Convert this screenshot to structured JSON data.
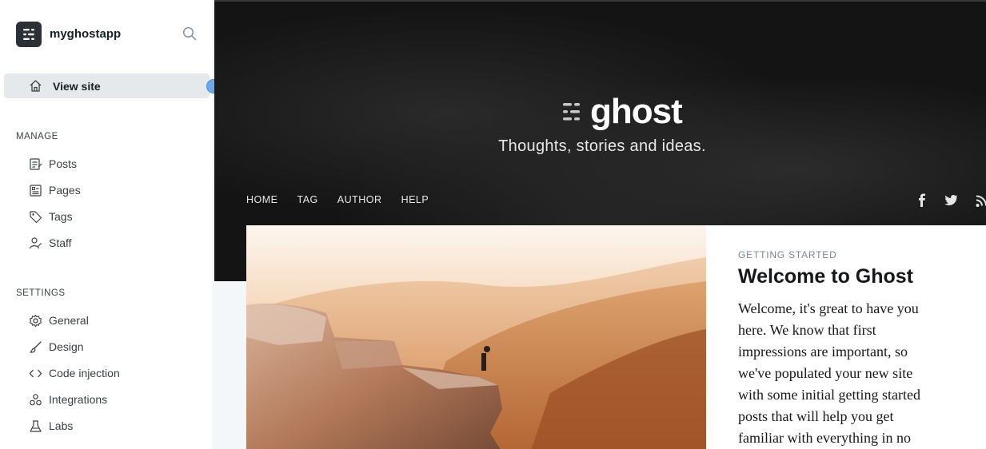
{
  "sidebar": {
    "site_name": "myghostapp",
    "view_site": {
      "label": "View site",
      "icon": "home-icon"
    },
    "manage": {
      "title": "MANAGE",
      "items": [
        {
          "label": "Posts",
          "icon": "posts-icon"
        },
        {
          "label": "Pages",
          "icon": "pages-icon"
        },
        {
          "label": "Tags",
          "icon": "tag-icon"
        },
        {
          "label": "Staff",
          "icon": "staff-icon"
        }
      ]
    },
    "settings": {
      "title": "SETTINGS",
      "items": [
        {
          "label": "General",
          "icon": "gear-icon"
        },
        {
          "label": "Design",
          "icon": "brush-icon"
        },
        {
          "label": "Code injection",
          "icon": "code-icon"
        },
        {
          "label": "Integrations",
          "icon": "integrations-icon"
        },
        {
          "label": "Labs",
          "icon": "flask-icon"
        }
      ]
    }
  },
  "site": {
    "logo_text": "ghost",
    "description": "Thoughts, stories and ideas.",
    "nav": [
      "HOME",
      "TAG",
      "AUTHOR",
      "HELP"
    ],
    "social": [
      "facebook-icon",
      "twitter-icon",
      "rss-icon"
    ],
    "featured_post": {
      "tag": "GETTING STARTED",
      "title": "Welcome to Ghost",
      "excerpt_lines": [
        "Welcome, it's great to have you",
        "here. We know that first",
        "impressions are important, so",
        "we've populated your new site",
        "with some initial getting started",
        "posts that will help you get",
        "familiar with everything in no"
      ]
    }
  },
  "colors": {
    "accent_active_bg": "#e6e9eb",
    "text_dark": "#15212a",
    "hero_bg": "#141414",
    "drag_handle": "#6ea8e6"
  }
}
